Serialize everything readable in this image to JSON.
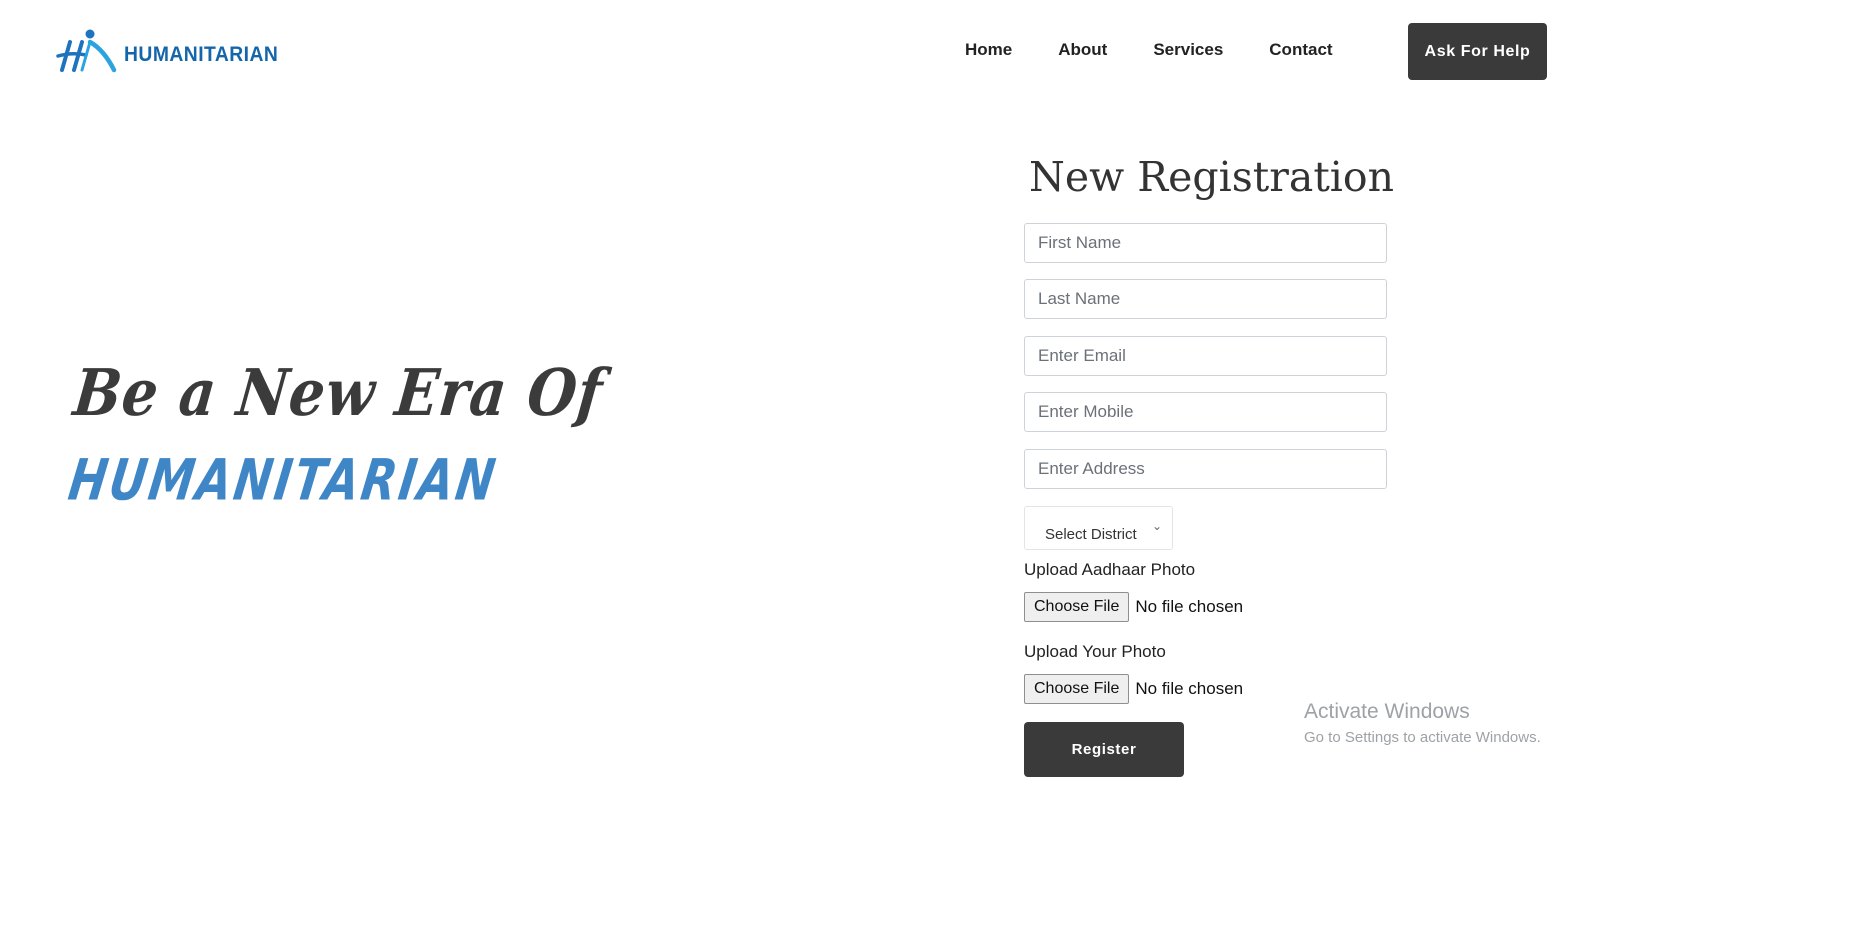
{
  "header": {
    "logo_text": "HUMANITARIAN",
    "logo_icon": "humanitarian-h-figure-logo",
    "nav": [
      "Home",
      "About",
      "Services",
      "Contact"
    ],
    "cta": "Ask For Help"
  },
  "hero": {
    "line1": "Be a New Era Of",
    "line2": "HUMANITARIAN"
  },
  "form": {
    "title": "New Registration",
    "fields": [
      {
        "placeholder": "First Name",
        "value": ""
      },
      {
        "placeholder": "Last Name",
        "value": ""
      },
      {
        "placeholder": "Enter Email",
        "value": ""
      },
      {
        "placeholder": "Enter Mobile",
        "value": ""
      },
      {
        "placeholder": "Enter Address",
        "value": ""
      }
    ],
    "district_select": "Select District",
    "uploads": [
      {
        "label": "Upload Aadhaar Photo",
        "button": "Choose File",
        "status": "No file chosen"
      },
      {
        "label": "Upload Your Photo",
        "button": "Choose File",
        "status": "No file chosen"
      }
    ],
    "submit": "Register"
  },
  "watermark": {
    "title": "Activate Windows",
    "subtitle": "Go to Settings to activate Windows."
  },
  "colors": {
    "brand_blue": "#1565ab",
    "hero_blue": "#3f86c6",
    "button_dark": "#3a3a3a"
  }
}
